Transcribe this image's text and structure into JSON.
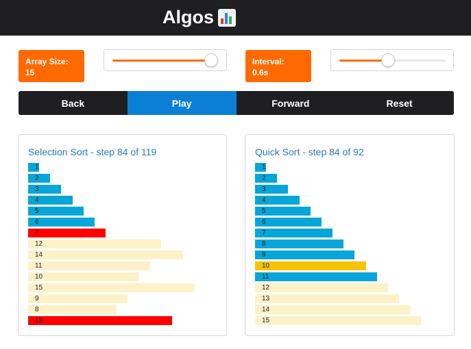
{
  "header": {
    "title": "Algos",
    "icon": "bar-chart-icon"
  },
  "array_size": {
    "label": "Array Size:",
    "value": "15",
    "slider_fraction": 0.93
  },
  "interval": {
    "label": "Interval:",
    "value": "0.6s",
    "slider_fraction": 0.46
  },
  "controls": {
    "back": "Back",
    "play": "Play",
    "forward": "Forward",
    "reset": "Reset"
  },
  "colors": {
    "accent": "#ff6a00",
    "sorted": "#07a6d6",
    "unsorted": "#fdf1c8",
    "selected_red": "#ff0000",
    "pivot_yellow": "#f5c400",
    "active_tab": "#0a7fd4"
  },
  "selection_sort": {
    "title": "Selection Sort - step 84 of 119",
    "bars": [
      {
        "value": 1,
        "state": "sorted"
      },
      {
        "value": 2,
        "state": "sorted"
      },
      {
        "value": 3,
        "state": "sorted"
      },
      {
        "value": 4,
        "state": "sorted"
      },
      {
        "value": 5,
        "state": "sorted"
      },
      {
        "value": 6,
        "state": "sorted"
      },
      {
        "value": 7,
        "state": "active-red"
      },
      {
        "value": 12,
        "state": "unsorted"
      },
      {
        "value": 14,
        "state": "unsorted"
      },
      {
        "value": 11,
        "state": "unsorted"
      },
      {
        "value": 10,
        "state": "unsorted"
      },
      {
        "value": 15,
        "state": "unsorted"
      },
      {
        "value": 9,
        "state": "unsorted"
      },
      {
        "value": 8,
        "state": "unsorted"
      },
      {
        "value": 13,
        "state": "active-red"
      }
    ]
  },
  "quick_sort": {
    "title": "Quick Sort - step 84 of 92",
    "bars": [
      {
        "value": 1,
        "state": "sorted"
      },
      {
        "value": 2,
        "state": "sorted"
      },
      {
        "value": 3,
        "state": "sorted"
      },
      {
        "value": 4,
        "state": "sorted"
      },
      {
        "value": 5,
        "state": "sorted"
      },
      {
        "value": 6,
        "state": "sorted"
      },
      {
        "value": 7,
        "state": "sorted"
      },
      {
        "value": 8,
        "state": "sorted"
      },
      {
        "value": 9,
        "state": "sorted"
      },
      {
        "value": 10,
        "state": "active-yellow"
      },
      {
        "value": 11,
        "state": "sorted"
      },
      {
        "value": 12,
        "state": "unsorted"
      },
      {
        "value": 13,
        "state": "unsorted"
      },
      {
        "value": 14,
        "state": "unsorted"
      },
      {
        "value": 15,
        "state": "unsorted"
      }
    ]
  }
}
